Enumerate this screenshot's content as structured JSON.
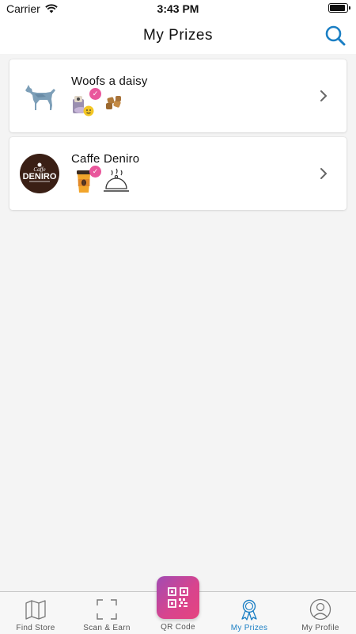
{
  "status_bar": {
    "carrier": "Carrier",
    "time": "3:43 PM",
    "icons": [
      "wifi-icon",
      "battery-icon"
    ]
  },
  "header": {
    "title": "My Prizes",
    "search_icon": "search-icon"
  },
  "stores": [
    {
      "name": "Woofs a daisy",
      "logo": "dog-logo",
      "prizes": [
        {
          "icon": "pet-toy-icon",
          "claimed": true
        },
        {
          "icon": "dog-treats-icon",
          "claimed": false
        }
      ]
    },
    {
      "name": "Caffe Deniro",
      "logo_text_top": "Caffe",
      "logo_text_main": "DENIRO",
      "prizes": [
        {
          "icon": "coffee-cup-icon",
          "claimed": true
        },
        {
          "icon": "food-cloche-icon",
          "claimed": false
        }
      ]
    }
  ],
  "tab_bar": {
    "tabs": [
      {
        "label": "Find Store",
        "icon": "map-icon"
      },
      {
        "label": "Scan & Earn",
        "icon": "scan-icon"
      },
      {
        "label": "QR Code",
        "icon": "qr-code-icon"
      },
      {
        "label": "My Prizes",
        "icon": "ribbon-award-icon",
        "active": true
      },
      {
        "label": "My Profile",
        "icon": "profile-icon"
      }
    ]
  },
  "colors": {
    "accent": "#1b7fc4",
    "badge": "#e9579c",
    "qr_gradient_start": "#a14bb3",
    "qr_gradient_end": "#e5457f"
  }
}
